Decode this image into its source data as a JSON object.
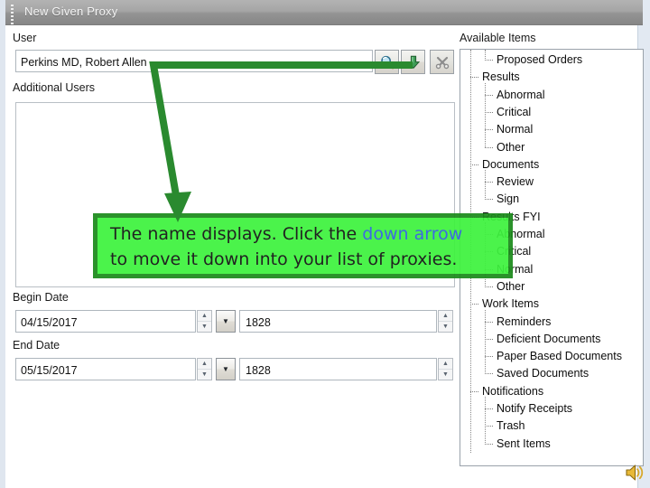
{
  "window": {
    "title": "New Given Proxy",
    "grip_icon": "drag-grip-icon"
  },
  "form": {
    "user_label": "User",
    "user_value": "Perkins MD, Robert Allen",
    "user_placeholder": "",
    "additional_users_label": "Additional Users",
    "additional_users_items": [],
    "begin_date_label": "Begin Date",
    "begin_date_value": "04/15/2017",
    "begin_time_value": "1828",
    "end_date_label": "End Date",
    "end_date_value": "05/15/2017",
    "end_time_value": "1828",
    "buttons": {
      "search_icon": "magnifier-icon",
      "search_title": "Search",
      "move_down_icon": "down-arrow-icon",
      "move_down_title": "Move Down",
      "tools_icon": "tools-x-icon",
      "tools_title": "Tools"
    },
    "spinner_up": "▲",
    "spinner_down": "▼",
    "dropdown_glyph": "▼"
  },
  "available": {
    "label": "Available Items",
    "items": [
      {
        "label": "Proposed Orders",
        "level": 2
      },
      {
        "label": "Results",
        "level": 1
      },
      {
        "label": "Abnormal",
        "level": 2
      },
      {
        "label": "Critical",
        "level": 2
      },
      {
        "label": "Normal",
        "level": 2
      },
      {
        "label": "Other",
        "level": 2,
        "last": true
      },
      {
        "label": "Documents",
        "level": 1
      },
      {
        "label": "Review",
        "level": 2
      },
      {
        "label": "Sign",
        "level": 2,
        "last": true
      },
      {
        "label": "Results FYI",
        "level": 1
      },
      {
        "label": "Abnormal",
        "level": 2
      },
      {
        "label": "Critical",
        "level": 2
      },
      {
        "label": "Normal",
        "level": 2
      },
      {
        "label": "Other",
        "level": 2,
        "last": true
      },
      {
        "label": "Work Items",
        "level": 1
      },
      {
        "label": "Reminders",
        "level": 2
      },
      {
        "label": "Deficient Documents",
        "level": 2
      },
      {
        "label": "Paper Based Documents",
        "level": 2
      },
      {
        "label": "Saved Documents",
        "level": 2,
        "last": true
      },
      {
        "label": "Notifications",
        "level": 1
      },
      {
        "label": "Notify Receipts",
        "level": 2
      },
      {
        "label": "Trash",
        "level": 2
      },
      {
        "label": "Sent Items",
        "level": 2,
        "last": true
      }
    ]
  },
  "callout": {
    "line1_a": "The name displays.  Click the ",
    "line1_highlight": "down arrow",
    "line2": "to move it down into your list of proxies.",
    "background": "#3ef33e",
    "border": "#1c8a1c",
    "highlight_color": "#2f5fe0"
  },
  "annotation": {
    "arrow_color": "#2a8a2f",
    "arrow_name": "green-pointer-arrow"
  },
  "statusbar": {
    "speaker_icon": "speaker-audio-icon"
  }
}
